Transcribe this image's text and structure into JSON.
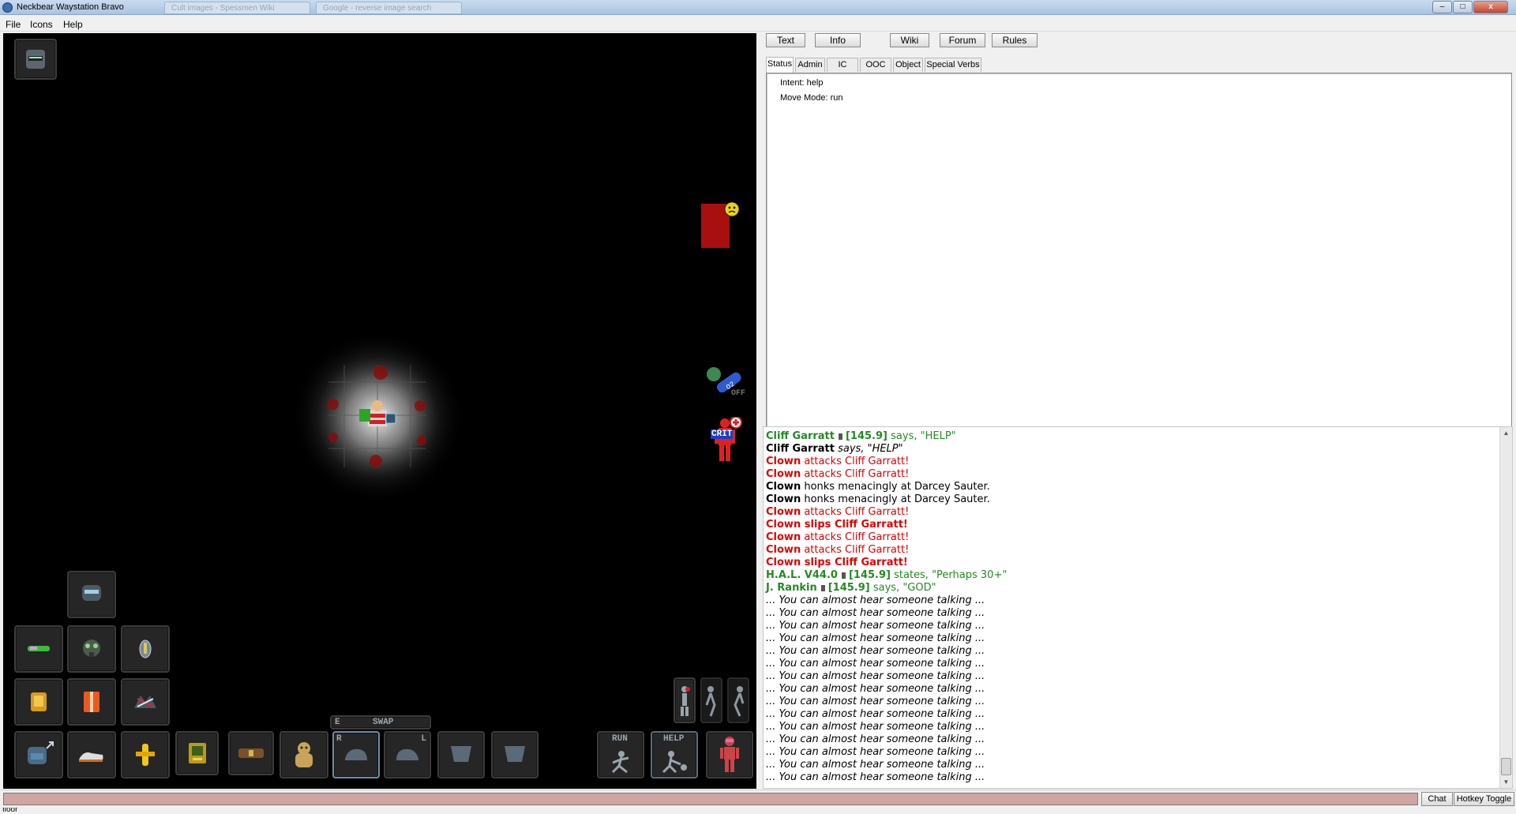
{
  "window": {
    "title": "Neckbear Waystation Bravo",
    "ghost_tabs": [
      "Cult images - Spessmen Wiki",
      "Google - reverse image search"
    ],
    "controls": {
      "minimize": "–",
      "maximize": "□",
      "close": "x"
    }
  },
  "menu": {
    "items": [
      "File",
      "Icons",
      "Help"
    ]
  },
  "game": {
    "hud": {
      "swap_label": "SWAP",
      "swap_key": "E",
      "hand_right": "R",
      "hand_left": "L",
      "run_label": "RUN",
      "help_label": "HELP",
      "internals_label": "OFF",
      "health_label": "CRIT"
    },
    "colors": {
      "background": "#000000",
      "hud_slot": "#262626",
      "hud_border": "#3c3c3c",
      "mood_red": "#a80f0f",
      "mood_face": "#e8d317"
    }
  },
  "right_panel": {
    "top_buttons": [
      "Text",
      "Info",
      "Wiki",
      "Forum",
      "Rules"
    ],
    "info_tabs": [
      "Status",
      "Admin",
      "IC",
      "OOC",
      "Object",
      "Special Verbs"
    ],
    "active_tab": "Status",
    "status_lines": [
      "Intent: help",
      "Move Mode: run"
    ],
    "chat": [
      {
        "name": "Cliff Garratt",
        "radio_icon": "radio-icon",
        "freq": "[145.9]",
        "text": " says, \"HELP\"",
        "color": "#228b22",
        "style": "radio"
      },
      {
        "name": "Cliff Garratt",
        "text": " says, \"HELP\"",
        "color": "#000000",
        "style": "say"
      },
      {
        "name": "Clown",
        "text": " attacks Cliff Garratt!",
        "color": "#e00000",
        "style": "attack"
      },
      {
        "name": "Clown",
        "text": " attacks Cliff Garratt!",
        "color": "#e00000",
        "style": "attack"
      },
      {
        "name": "Clown",
        "text": " honks menacingly at Darcey Sauter.",
        "color": "#000000",
        "style": "emote"
      },
      {
        "name": "Clown",
        "text": " honks menacingly at Darcey Sauter.",
        "color": "#000000",
        "style": "emote"
      },
      {
        "name": "Clown",
        "text": " attacks Cliff Garratt!",
        "color": "#e00000",
        "style": "attack"
      },
      {
        "name": "Clown",
        "text": " slips Cliff Garratt!",
        "color": "#e00000",
        "style": "bold"
      },
      {
        "name": "Clown",
        "text": " attacks Cliff Garratt!",
        "color": "#e00000",
        "style": "attack"
      },
      {
        "name": "Clown",
        "text": " attacks Cliff Garratt!",
        "color": "#e00000",
        "style": "attack"
      },
      {
        "name": "Clown",
        "text": " slips Cliff Garratt!",
        "color": "#e00000",
        "style": "bold"
      },
      {
        "name": "H.A.L. V44.0",
        "radio_icon": "pda-icon",
        "freq": "[145.9]",
        "text": " states, \"Perhaps 30+\"",
        "color": "#228b22",
        "style": "radio"
      },
      {
        "name": "J. Rankin",
        "radio_icon": "radio-icon",
        "freq": "[145.9]",
        "text": " says, \"GOD\"",
        "color": "#228b22",
        "style": "radio"
      },
      {
        "text": "... You can almost hear someone talking ...",
        "style": "whisper"
      },
      {
        "text": "... You can almost hear someone talking ...",
        "style": "whisper"
      },
      {
        "text": "... You can almost hear someone talking ...",
        "style": "whisper"
      },
      {
        "text": "... You can almost hear someone talking ...",
        "style": "whisper"
      },
      {
        "text": "... You can almost hear someone talking ...",
        "style": "whisper"
      },
      {
        "text": "... You can almost hear someone talking ...",
        "style": "whisper"
      },
      {
        "text": "... You can almost hear someone talking ...",
        "style": "whisper"
      },
      {
        "text": "... You can almost hear someone talking ...",
        "style": "whisper"
      },
      {
        "text": "... You can almost hear someone talking ...",
        "style": "whisper"
      },
      {
        "text": "... You can almost hear someone talking ...",
        "style": "whisper"
      },
      {
        "text": "... You can almost hear someone talking ...",
        "style": "whisper"
      },
      {
        "text": "... You can almost hear someone talking ...",
        "style": "whisper"
      },
      {
        "text": "... You can almost hear someone talking ...",
        "style": "whisper"
      },
      {
        "text": "... You can almost hear someone talking ...",
        "style": "whisper"
      },
      {
        "text": "... You can almost hear someone talking ...",
        "style": "whisper"
      }
    ]
  },
  "input_bar": {
    "value": "",
    "chat_button": "Chat",
    "hotkey_button": "Hotkey Toggle"
  },
  "statusbar": {
    "text": "floor"
  }
}
